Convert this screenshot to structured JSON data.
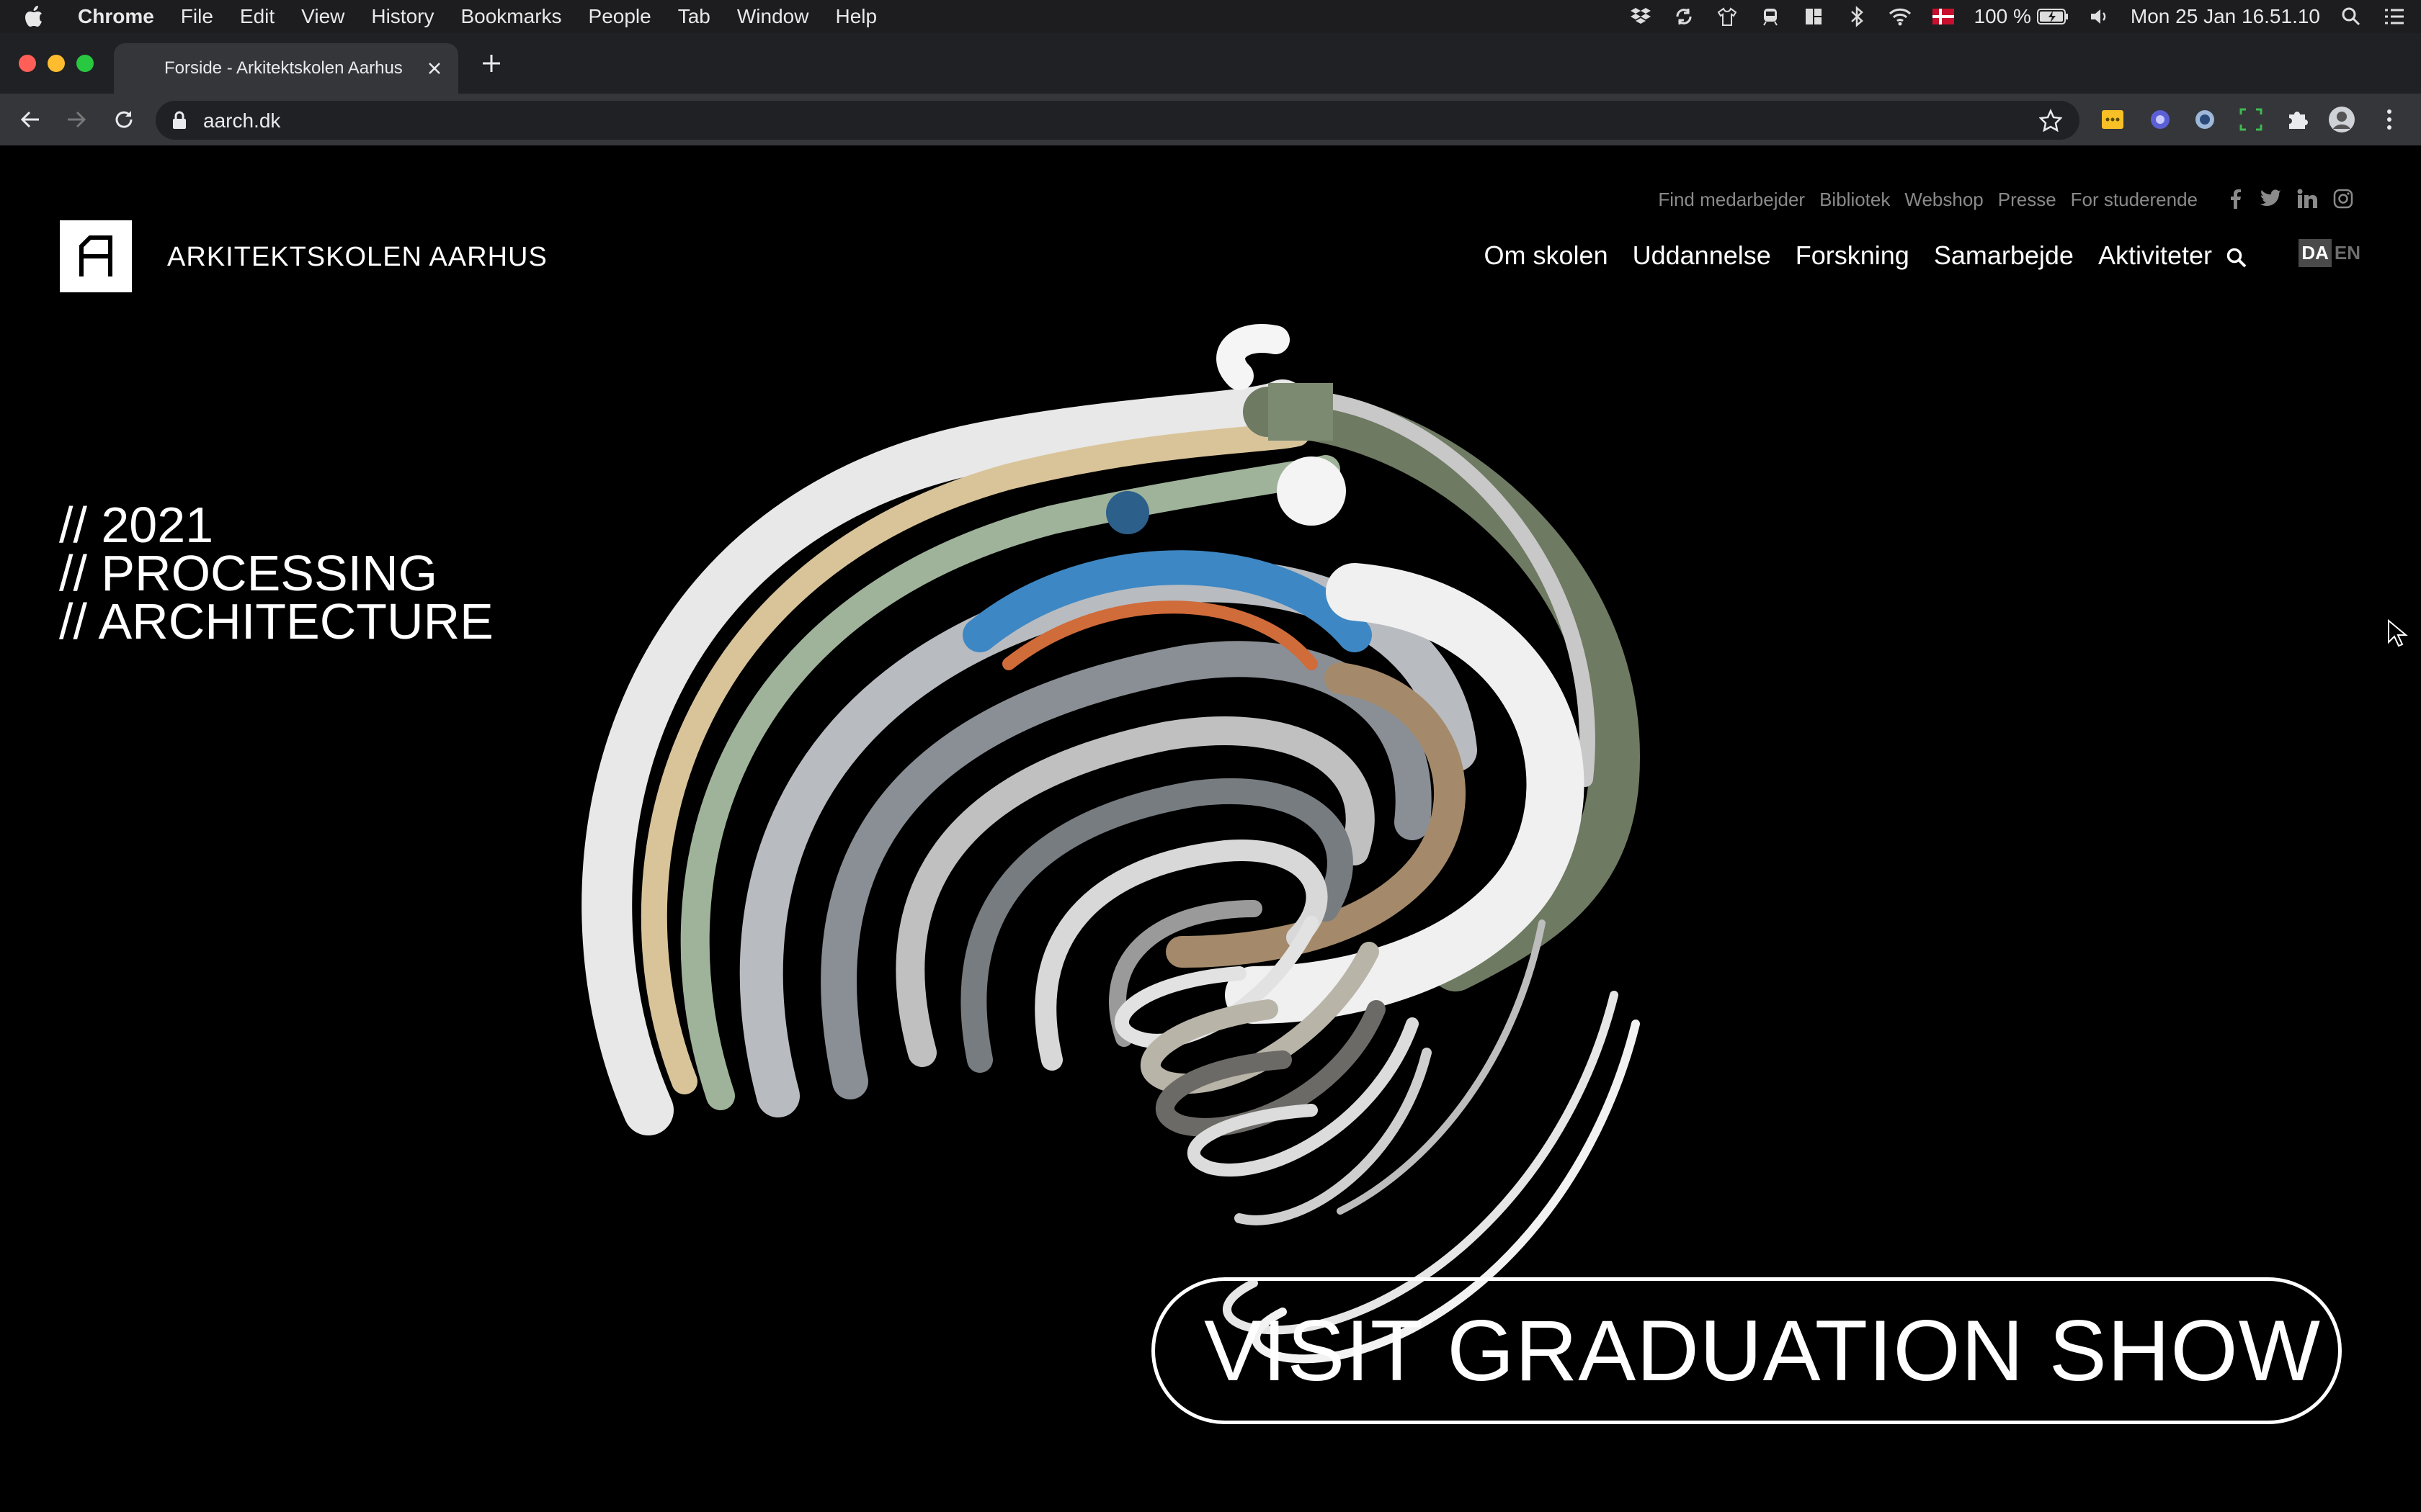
{
  "menubar": {
    "app": "Chrome",
    "items": [
      "File",
      "Edit",
      "View",
      "History",
      "Bookmarks",
      "People",
      "Tab",
      "Window",
      "Help"
    ],
    "battery": "100 %",
    "clock": "Mon 25 Jan  16.51.10"
  },
  "browser": {
    "tab_title": "Forside - Arkitektskolen Aarhus",
    "url": "aarch.dk"
  },
  "site": {
    "brand": "ARKITEKTSKOLEN AARHUS",
    "utility_links": [
      "Find medarbejder",
      "Bibliotek",
      "Webshop",
      "Presse",
      "For studerende"
    ],
    "social": [
      "facebook-icon",
      "twitter-icon",
      "linkedin-icon",
      "instagram-icon"
    ],
    "main_nav": [
      "Om skolen",
      "Uddannelse",
      "Forskning",
      "Samarbejde",
      "Aktiviteter"
    ],
    "lang": {
      "da": "DA",
      "en": "EN"
    },
    "hero": [
      "// 2021",
      "// PROCESSING",
      "// ARCHITECTURE"
    ],
    "cta": "VISIT GRADUATION SHOW"
  },
  "colors": {
    "page_bg": "#000000",
    "menubar_bg": "#1d1d1f",
    "tabstrip_bg": "#202124",
    "toolbar_bg": "#35363a",
    "utility_text": "#8a8a8a"
  }
}
